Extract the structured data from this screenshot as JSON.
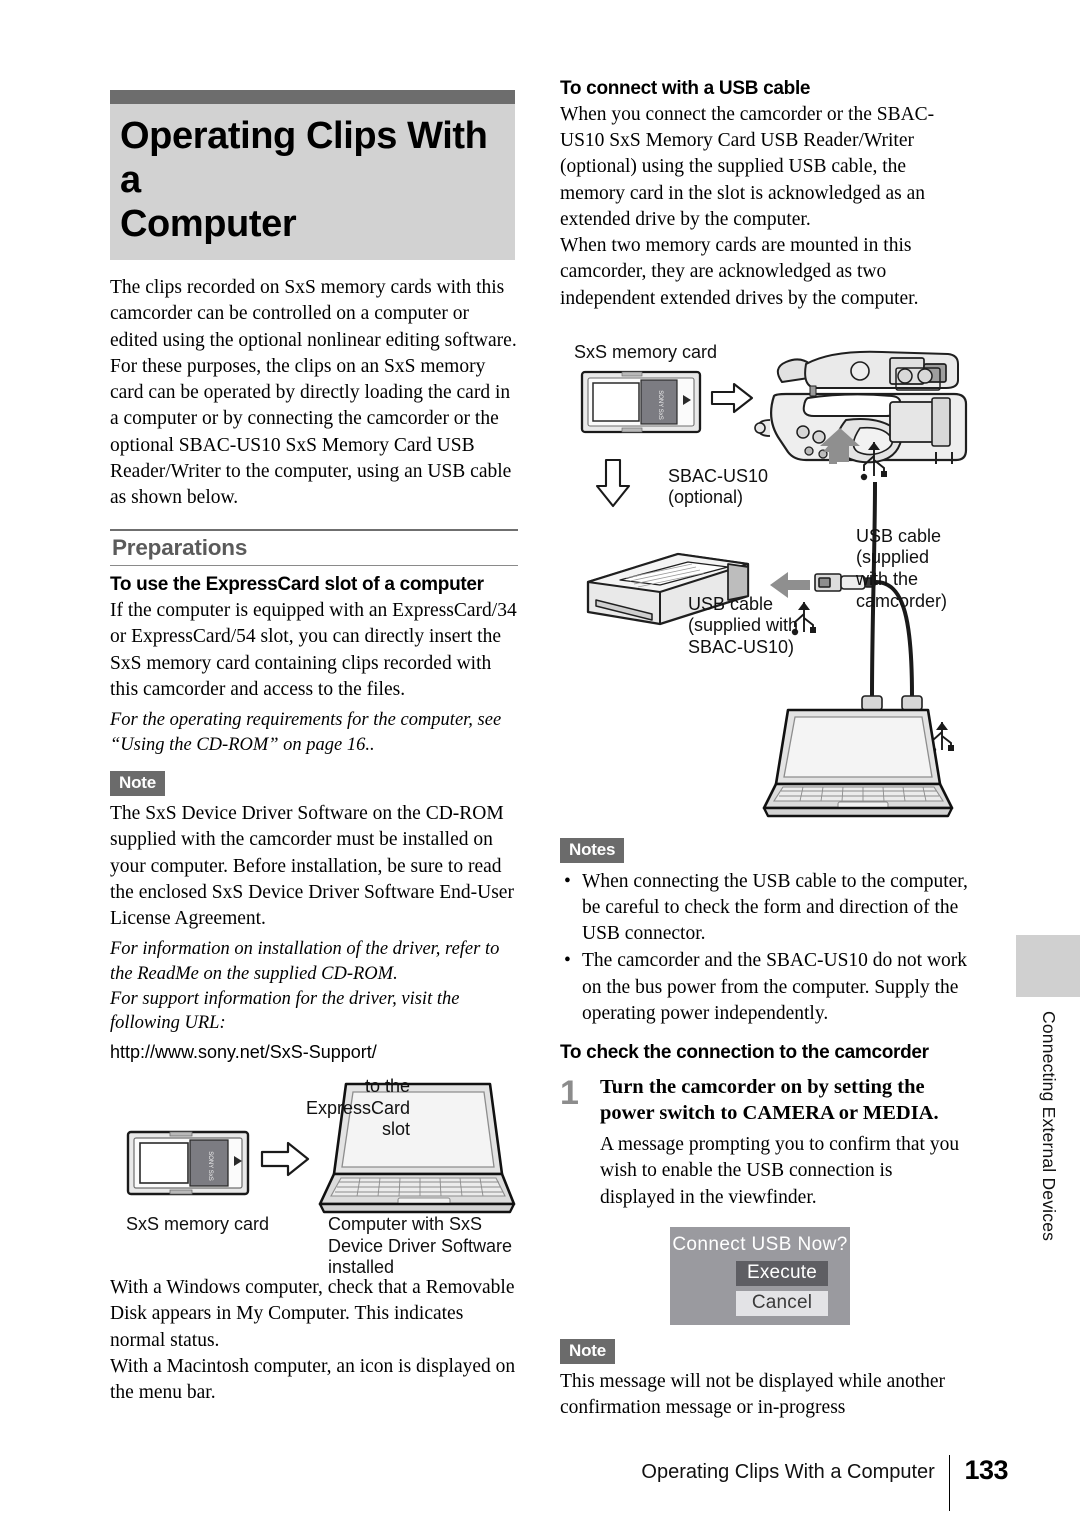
{
  "page": {
    "number": "133",
    "footer_title": "Operating Clips With a Computer",
    "side_tab": "Connecting External Devices"
  },
  "title": {
    "line1": "Operating Clips With a",
    "line2": "Computer"
  },
  "left_column": {
    "intro_p1": "The clips recorded on SxS memory cards with this camcorder can be controlled on a computer or edited using the optional nonlinear editing software.",
    "intro_p2": "For these purposes, the clips on an SxS memory card can be operated by directly loading the card in a computer or by connecting the camcorder or the optional SBAC-US10 SxS Memory Card USB Reader/Writer to the computer, using an USB cable as shown below.",
    "section_heading": "Preparations",
    "subhead_expresscard": "To use the ExpressCard slot of a computer",
    "expresscard_body": "If the computer is equipped with an ExpressCard/34 or ExpressCard/54 slot, you can directly insert the SxS memory card containing clips recorded with this camcorder and access to the files.",
    "expresscard_ref": "For the operating requirements for the computer, see “Using the CD-ROM” on page 16..",
    "note_badge": "Note",
    "note_body": "The SxS Device Driver Software on the CD-ROM supplied with the camcorder must be installed on your computer. Before installation, be sure to read the enclosed SxS Device Driver Software End-User License Agreement.",
    "note_ref1": "For information on installation of the driver, refer to the ReadMe on the supplied CD-ROM.",
    "note_ref2": "For support information for the driver, visit the following URL:",
    "url": "http://www.sony.net/SxS-Support/",
    "figure_expresscard": {
      "label_card": "SxS memory card",
      "label_slot": "to the\nExpressCard\nslot",
      "label_computer": "Computer with SxS\nDevice Driver Software\ninstalled"
    },
    "closing_p1": "With a Windows computer, check that a Removable Disk appears in My Computer. This indicates normal status.",
    "closing_p2": "With a Macintosh computer, an icon is displayed on the menu bar."
  },
  "right_column": {
    "subhead_usb": "To connect with a USB cable",
    "usb_p1": "When you connect the camcorder or the SBAC-US10 SxS Memory Card USB Reader/Writer (optional) using the supplied USB cable, the memory card in the slot is acknowledged as an extended drive by the computer.",
    "usb_p2": "When two memory cards are mounted in this camcorder, they are acknowledged as two independent extended drives by the computer.",
    "figure_usb": {
      "label_card": "SxS memory card",
      "label_sbac": "SBAC-US10\n(optional)",
      "label_cable_camcorder": "USB cable\n(supplied\nwith the\ncamcorder)",
      "label_cable_sbac": "USB cable\n(supplied with\nSBAC-US10)"
    },
    "notes_badge": "Notes",
    "notes": [
      "When connecting the USB cable to the computer, be careful to check the form and direction of the USB connector.",
      "The camcorder and the SBAC-US10 do not work on the bus power from the computer. Supply the operating power independently."
    ],
    "subhead_check": "To check the connection to the camcorder",
    "step1": {
      "number": "1",
      "title": "Turn the camcorder on by setting the power switch to CAMERA or MEDIA.",
      "body": "A message prompting you to confirm that you wish to enable the USB connection is displayed in the viewfinder."
    },
    "viewfinder": {
      "title": "Connect USB Now?",
      "button_execute": "Execute",
      "button_cancel": "Cancel"
    },
    "note_badge": "Note",
    "note_body": "This message will not be displayed while another confirmation message or in-progress"
  },
  "colors": {
    "title_bg": "#d2d2d2",
    "title_bar": "#6d6d6d",
    "note_badge_bg": "#6b6b6b",
    "section_heading": "#5b5b5b",
    "step_number": "#8c8c8c",
    "viewfinder_bg": "#9a9a9f",
    "viewfinder_sel": "#5e5e63",
    "viewfinder_unsel": "#e3e3e6",
    "side_tab_block": "#d0d0d0"
  }
}
